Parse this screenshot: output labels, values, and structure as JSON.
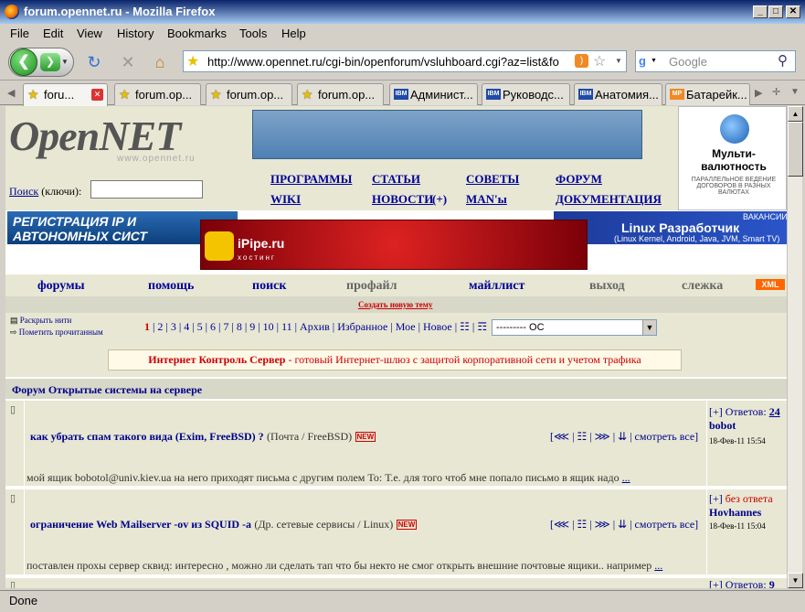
{
  "window": {
    "title": "forum.opennet.ru - Mozilla Firefox",
    "min": "_",
    "max": "□",
    "close": "✕"
  },
  "menu": [
    "File",
    "Edit",
    "View",
    "History",
    "Bookmarks",
    "Tools",
    "Help"
  ],
  "address": {
    "url": "http://www.opennet.ru/cgi-bin/openforum/vsluhboard.cgi?az=list&fo"
  },
  "search": {
    "placeholder": "Google"
  },
  "tabs": [
    "foru...",
    "forum.op...",
    "forum.op...",
    "forum.op...",
    "Админист...",
    "Руководс...",
    "Анатомия...",
    "Батарейк..."
  ],
  "site": {
    "logo": "OpenNET",
    "logo_sub": "www.opennet.ru",
    "search_label": "Поиск",
    "search_hint": "(ключи):",
    "links_row1": [
      "ПРОГРАММЫ",
      "СТАТЬИ",
      "СОВЕТЫ",
      "ФОРУМ"
    ],
    "links_row2": [
      "WIKI",
      "НОВОСТИ",
      "MAN'ы",
      "ДОКУМЕНТАЦИЯ"
    ],
    "news_plus": "(+)",
    "ad_right": {
      "title": "Мульти-валютность",
      "sub": "ПАРАЛЛЕЛЬНОЕ ВЕДЕНИЕ ДОГОВОРОВ В РАЗНЫХ ВАЛЮТАХ"
    },
    "banner_left": "РЕГИСТРАЦИЯ IP И АВТОНОМНЫХ СИСТ",
    "banner_mid": "iPipe.ru",
    "banner_mid_sub": "хостинг",
    "banner_right_tag": "ВАКАНСИИ",
    "banner_right": "Linux Разработчик",
    "banner_right_sub": "(Linux Kernel, Android, Java, JVM, Smart TV)"
  },
  "forum_nav": [
    "форумы",
    "помощь",
    "поиск",
    "профайл",
    "майллист",
    "выход",
    "слежка"
  ],
  "xml_badge": "XML",
  "new_topic": "Создать новую тему",
  "expand": "Раскрыть нити",
  "mark_read": "Пометить прочитанным",
  "pages": [
    "1",
    "2",
    "3",
    "4",
    "5",
    "6",
    "7",
    "8",
    "9",
    "10",
    "11"
  ],
  "page_links": [
    "Архив",
    "Избранное",
    "Мое",
    "Новое"
  ],
  "section_select": "--------- OC",
  "promo": {
    "title": "Интернет Контроль Сервер",
    "text": " - готовый Интернет-шлюз с защитой корпоративной сети и учетом трафика"
  },
  "forum_title": "Форум  Открытые системы на сервере",
  "topics": [
    {
      "title": "как убрать спам такого вида (Exim, FreeBSD) ?",
      "cat1": "Почта",
      "cat2": "FreeBSD",
      "new": "NEW",
      "controls": "[⋘ | ☷ | ⋙ | ⇊ | смотреть все]",
      "desc": "мой ящик bobotol@univ.kiev.ua на него приходят письма с другим полем To: Т.е. для того чтоб мне попало письмо в ящик надо",
      "more": "...",
      "answers_label": "[+] Ответов:",
      "answers": "24",
      "author": "bobot",
      "date": "18-Фев-11 15:54"
    },
    {
      "title": "ограничение Web Mailserver -ov  из SQUID -a",
      "cat1": "Др. сетевые сервисы",
      "cat2": "Linux",
      "new": "NEW",
      "controls": "[⋘ | ☷ | ⋙ | ⇊ | смотреть все]",
      "desc": "поставлен прохы сервер сквид: интересно , можно ли сделать тап что бы некто не смог открыть внешние почтовые ящики.. например",
      "more": "...",
      "answers_label": "[+]",
      "answers": "без ответа",
      "author": "Hovhannes",
      "date": "18-Фев-11 15:04"
    },
    {
      "answers_label": "[+] Ответов:",
      "answers": "9"
    }
  ],
  "status": "Done"
}
